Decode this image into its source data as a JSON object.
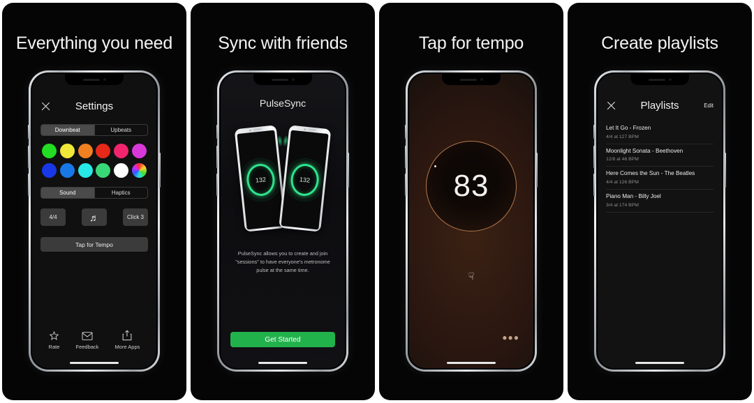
{
  "panels": [
    {
      "title": "Everything you need",
      "screen": {
        "kind": "settings",
        "close_icon": "close-icon",
        "header_title": "Settings",
        "beat_segments": [
          {
            "label": "Downbeat",
            "active": true
          },
          {
            "label": "Upbeats",
            "active": false
          }
        ],
        "colors_row1": [
          "#22dd22",
          "#f0e838",
          "#f08020",
          "#e82818",
          "#f0256e",
          "#d838d8"
        ],
        "colors_row2": [
          "#1838e8",
          "#1878e8",
          "#28e8e8",
          "#38d878",
          "#ffffff",
          "rainbow"
        ],
        "output_segments": [
          {
            "label": "Sound",
            "active": true
          },
          {
            "label": "Haptics",
            "active": false
          }
        ],
        "control_buttons": [
          {
            "label": "4/4",
            "icon": ""
          },
          {
            "label": "",
            "icon": "music-note-icon"
          },
          {
            "label": "Click 3",
            "icon": ""
          }
        ],
        "tap_tempo_label": "Tap for Tempo",
        "footer_items": [
          {
            "label": "Rate",
            "icon": "star-icon"
          },
          {
            "label": "Feedback",
            "icon": "envelope-icon"
          },
          {
            "label": "More Apps",
            "icon": "share-icon"
          }
        ]
      }
    },
    {
      "title": "Sync with friends",
      "screen": {
        "kind": "pulsesync",
        "app_name": "PulseSync",
        "device_left_bpm": "132",
        "device_right_bpm": "132",
        "description": "PulseSync allows you to create and join \"sessions\" to have everyone's metronome pulse at the same time.",
        "cta_label": "Get Started",
        "cta_color": "#22b24c"
      }
    },
    {
      "title": "Tap for tempo",
      "screen": {
        "kind": "tempo",
        "bpm": "83",
        "tap_icon": "tap-hand-icon",
        "more_icon": "ellipsis-icon",
        "ring_color": "#b4774a"
      }
    },
    {
      "title": "Create playlists",
      "screen": {
        "kind": "playlists",
        "close_icon": "close-icon",
        "header_title": "Playlists",
        "edit_label": "Edit",
        "items": [
          {
            "title": "Let It Go - Frozen",
            "subtitle": "4/4 at 127 BPM"
          },
          {
            "title": "Moonlight Sonata - Beethoven",
            "subtitle": "12/8 at 46 BPM"
          },
          {
            "title": "Here Comes the Sun - The Beatles",
            "subtitle": "4/4 at 126 BPM"
          },
          {
            "title": "Piano Man - Billy Joel",
            "subtitle": "3/4 at 174 BPM"
          }
        ]
      }
    }
  ]
}
